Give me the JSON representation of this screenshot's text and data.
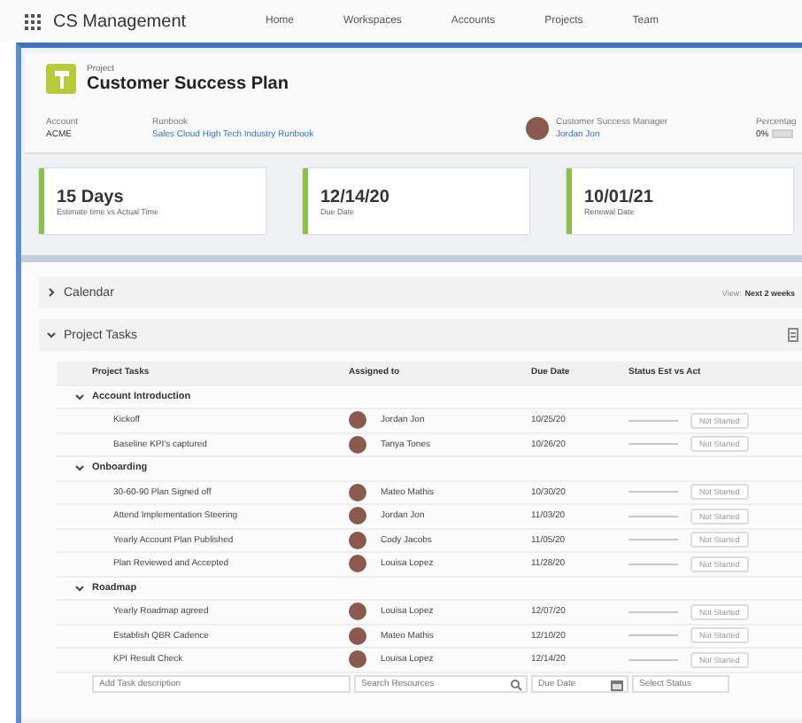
{
  "app": {
    "title": "CS Management"
  },
  "nav": [
    {
      "label": "Home",
      "selected": false
    },
    {
      "label": "Workspaces",
      "selected": false
    },
    {
      "label": "Accounts",
      "selected": false
    },
    {
      "label": "Projects",
      "selected": false
    },
    {
      "label": "Team",
      "selected": false
    }
  ],
  "record": {
    "type": "Project",
    "title": "Customer Success Plan",
    "fields": [
      {
        "label": "Account",
        "value": "ACME",
        "kind": "text"
      },
      {
        "label": "Runbook",
        "value": "Sales Cloud High Tech Industry Runbook",
        "kind": "link"
      },
      {
        "label": "Customer Success Manager",
        "value": "Jordan Jon",
        "kind": "person"
      },
      {
        "label": "Percentag",
        "value": "0%",
        "kind": "progress",
        "level": 0
      }
    ]
  },
  "cards": [
    {
      "value": "15 Days",
      "label": "Estimate time vs Actual Time"
    },
    {
      "value": "12/14/20",
      "label": "Due Date"
    },
    {
      "value": "10/01/21",
      "label": "Renewal Date"
    }
  ],
  "calendar": {
    "title": "Calendar",
    "expanded": false,
    "view_label": "View:",
    "view_value": "Next 2 weeks"
  },
  "tasks": {
    "title": "Project Tasks",
    "expanded": true,
    "columns": [
      "Project Tasks",
      "Assigned to",
      "Due Date",
      "Status Est vs Act"
    ],
    "groups": [
      {
        "name": "Account Introduction",
        "expanded": true,
        "rows": [
          {
            "task": "Kickoff",
            "assignee": "Jordan Jon",
            "due": "10/25/20",
            "level": 0,
            "status": "Not Started"
          },
          {
            "task": "Baseline KPI's captured",
            "assignee": "Tanya Tones",
            "due": "10/26/20",
            "level": 0,
            "status": "Not Started"
          }
        ]
      },
      {
        "name": "Onboarding",
        "expanded": true,
        "rows": [
          {
            "task": "30-60-90 Plan Signed off",
            "assignee": "Mateo Mathis",
            "due": "10/30/20",
            "level": 0,
            "status": "Not Started"
          },
          {
            "task": "Attend Implementation Steering",
            "assignee": "Jordan Jon",
            "due": "11/03/20",
            "level": 0,
            "status": "Not Started"
          },
          {
            "task": "Yearly Account Plan Published",
            "assignee": "Cody Jacobs",
            "due": "11/05/20",
            "level": 0,
            "status": "Not Started"
          },
          {
            "task": "Plan Reviewed and Accepted",
            "assignee": "Louisa Lopez",
            "due": "11/28/20",
            "level": 0,
            "status": "Not Started"
          }
        ]
      },
      {
        "name": "Roadmap",
        "expanded": true,
        "rows": [
          {
            "task": "Yearly Roadmap agreed",
            "assignee": "Louisa Lopez",
            "due": "12/07/20",
            "level": 0,
            "status": "Not Started"
          },
          {
            "task": "Establish QBR Cadence",
            "assignee": "Mateo Mathis",
            "due": "12/10/20",
            "level": 0,
            "status": "Not Started"
          },
          {
            "task": "KPI Result Check",
            "assignee": "Louisa Lopez",
            "due": "12/14/20",
            "level": 0,
            "status": "Not Started"
          }
        ]
      }
    ],
    "new_row": {
      "task_placeholder": "Add Task description",
      "resource_placeholder": "Search Resources",
      "date_placeholder": "Due Date",
      "status_placeholder": "Select Status"
    }
  }
}
